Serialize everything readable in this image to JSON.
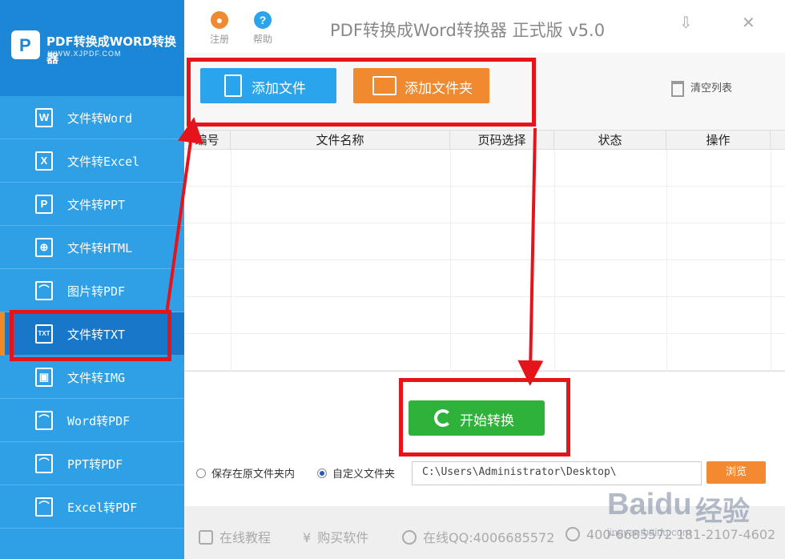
{
  "logo": {
    "title": "PDF转换成WORD转换器",
    "url": "WWW.XJPDF.COM",
    "mark": "P"
  },
  "sidebar": {
    "items": [
      {
        "icon": "word-icon",
        "glyph": "W",
        "label": "文件转Word"
      },
      {
        "icon": "excel-icon",
        "glyph": "X",
        "label": "文件转Excel"
      },
      {
        "icon": "ppt-icon",
        "glyph": "P",
        "label": "文件转PPT"
      },
      {
        "icon": "globe-icon",
        "glyph": "⊕",
        "label": "文件转HTML"
      },
      {
        "icon": "pdf-icon",
        "glyph": "⌒",
        "label": "图片转PDF"
      },
      {
        "icon": "txt-icon",
        "glyph": "TXT",
        "label": "文件转TXT"
      },
      {
        "icon": "image-icon",
        "glyph": "▣",
        "label": "文件转IMG"
      },
      {
        "icon": "pdf-icon",
        "glyph": "⌒",
        "label": "Word转PDF"
      },
      {
        "icon": "pdf-icon",
        "glyph": "⌒",
        "label": "PPT转PDF"
      },
      {
        "icon": "pdf-icon",
        "glyph": "⌒",
        "label": "Excel转PDF"
      }
    ],
    "active_index": 5
  },
  "topbar": {
    "register": "注册",
    "help": "帮助",
    "title": "PDF转换成Word转换器 正式版 v5.0",
    "minimize": "⇩",
    "close": "✕"
  },
  "toolbar": {
    "add_file": "添加文件",
    "add_folder": "添加文件夹",
    "clear": "清空列表"
  },
  "table": {
    "columns": [
      "编号",
      "文件名称",
      "页码选择",
      "状态",
      "操作"
    ],
    "rows": []
  },
  "actions": {
    "start": "开始转换"
  },
  "output": {
    "opt_original": "保存在原文件夹内",
    "opt_custom": "自定义文件夹",
    "selected": "opt_custom",
    "path": "C:\\Users\\Administrator\\Desktop\\",
    "browse": "浏览"
  },
  "footer": {
    "tutorial": "在线教程",
    "buy": "购买软件",
    "qq": "在线QQ:4006685572",
    "phone": "400-6685572 181-2107-4602"
  },
  "colors": {
    "sidebar": "#2f9fe6",
    "active": "#1877c9",
    "blue_btn": "#2ba4ee",
    "orange_btn": "#ef8a30",
    "green_btn": "#2fb239",
    "annotation": "#e5141b"
  },
  "watermark": {
    "brand": "Baidu",
    "cn": "经验",
    "url": "jingyan.baidu.com"
  }
}
